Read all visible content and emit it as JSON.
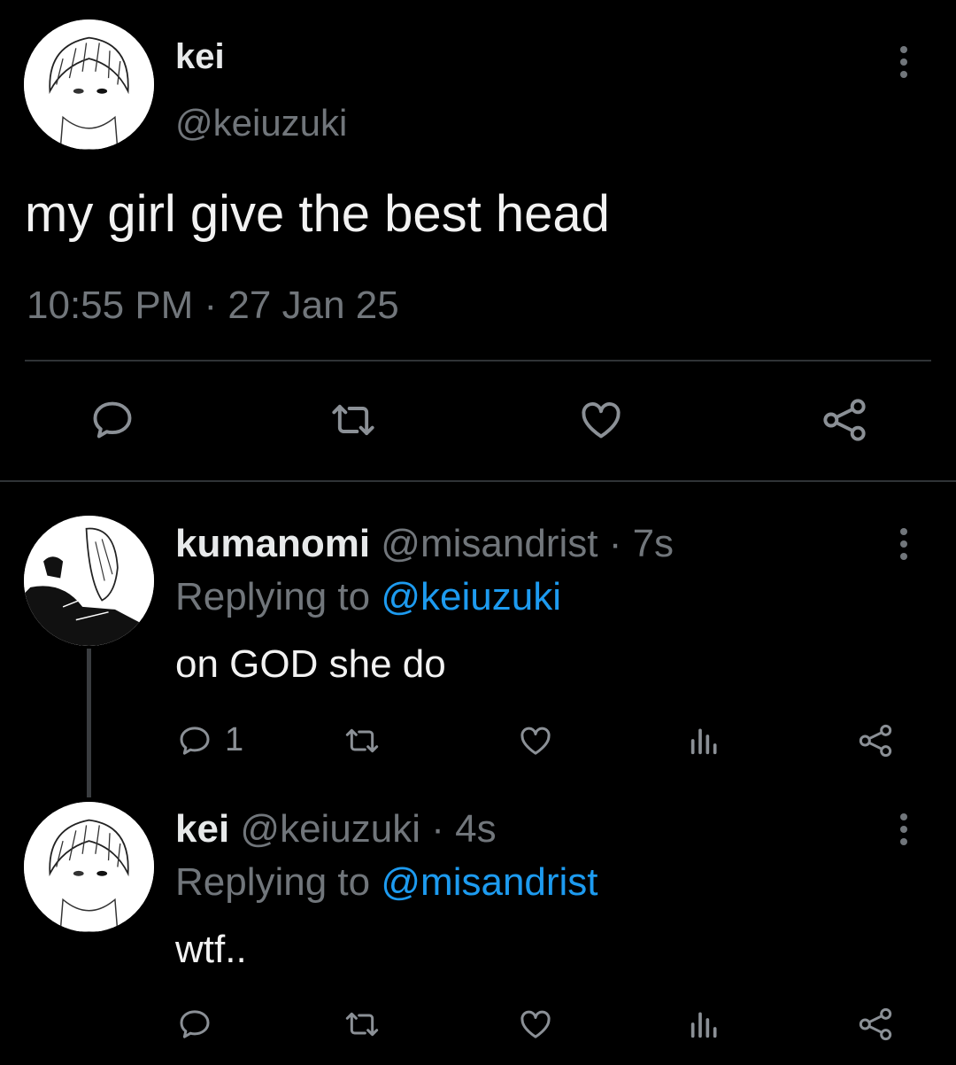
{
  "main_tweet": {
    "display_name": "kei",
    "handle": "@keiuzuki",
    "text": "my girl give the best head",
    "timestamp": "10:55 PM · 27 Jan 25"
  },
  "replies": [
    {
      "display_name": "kumanomi",
      "handle": "@misandrist",
      "time": "· 7s",
      "replying_prefix": "Replying to",
      "replying_to": "@keiuzuki",
      "text": "on GOD she do",
      "reply_count": "1"
    },
    {
      "display_name": "kei",
      "handle": "@keiuzuki",
      "time": "· 4s",
      "replying_prefix": "Replying to",
      "replying_to": "@misandrist",
      "text": "wtf..",
      "reply_count": ""
    }
  ],
  "icons": {
    "reply": "reply-icon",
    "retweet": "retweet-icon",
    "like": "heart-icon",
    "views": "views-icon",
    "share": "share-icon",
    "more": "more-icon"
  },
  "colors": {
    "background": "#000000",
    "text": "#e7e9ea",
    "muted": "#71767b",
    "link": "#1d9bf0",
    "divider": "#2f3336"
  }
}
